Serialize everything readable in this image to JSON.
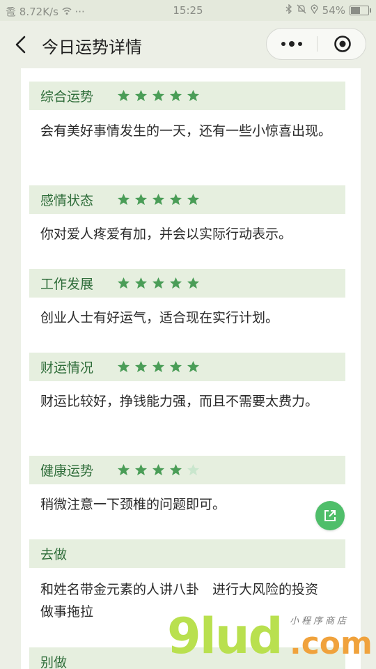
{
  "status_bar": {
    "left_text": "卺",
    "network_speed": "8.72K/s",
    "more_dots": "···",
    "time": "15:25",
    "battery_percent": "54%"
  },
  "nav": {
    "title": "今日运势详情"
  },
  "sections": [
    {
      "label": "综合运势",
      "stars": 5,
      "text": "会有美好事情发生的一天，还有一些小惊喜出现。"
    },
    {
      "label": "感情状态",
      "stars": 5,
      "text": "你对爱人疼爱有加，并会以实际行动表示。"
    },
    {
      "label": "工作发展",
      "stars": 5,
      "text": "创业人士有好运气，适合现在实行计划。"
    },
    {
      "label": "财运情况",
      "stars": 5,
      "text": "财运比较好，挣钱能力强，而且不需要太费力。"
    },
    {
      "label": "健康运势",
      "stars": 4,
      "text": "稍微注意一下颈椎的问题即可。"
    },
    {
      "label": "去做",
      "stars": 0,
      "text": "和姓名带金元素的人讲八卦　进行大风险的投资　做事拖拉"
    },
    {
      "label": "别做",
      "stars": 0,
      "text": ""
    }
  ],
  "watermark": {
    "brand": "9lud",
    "suffix": ".com",
    "tagline": "小程序商店"
  },
  "colors": {
    "accent": "#4aa85c",
    "star_filled": "#4a9d57",
    "star_empty": "#c9e6cd",
    "section_bg": "#e6efdf"
  },
  "icons": {
    "back": "chevron-left-icon",
    "more": "more-dots-icon",
    "close": "target-circle-icon",
    "share": "share-icon"
  }
}
